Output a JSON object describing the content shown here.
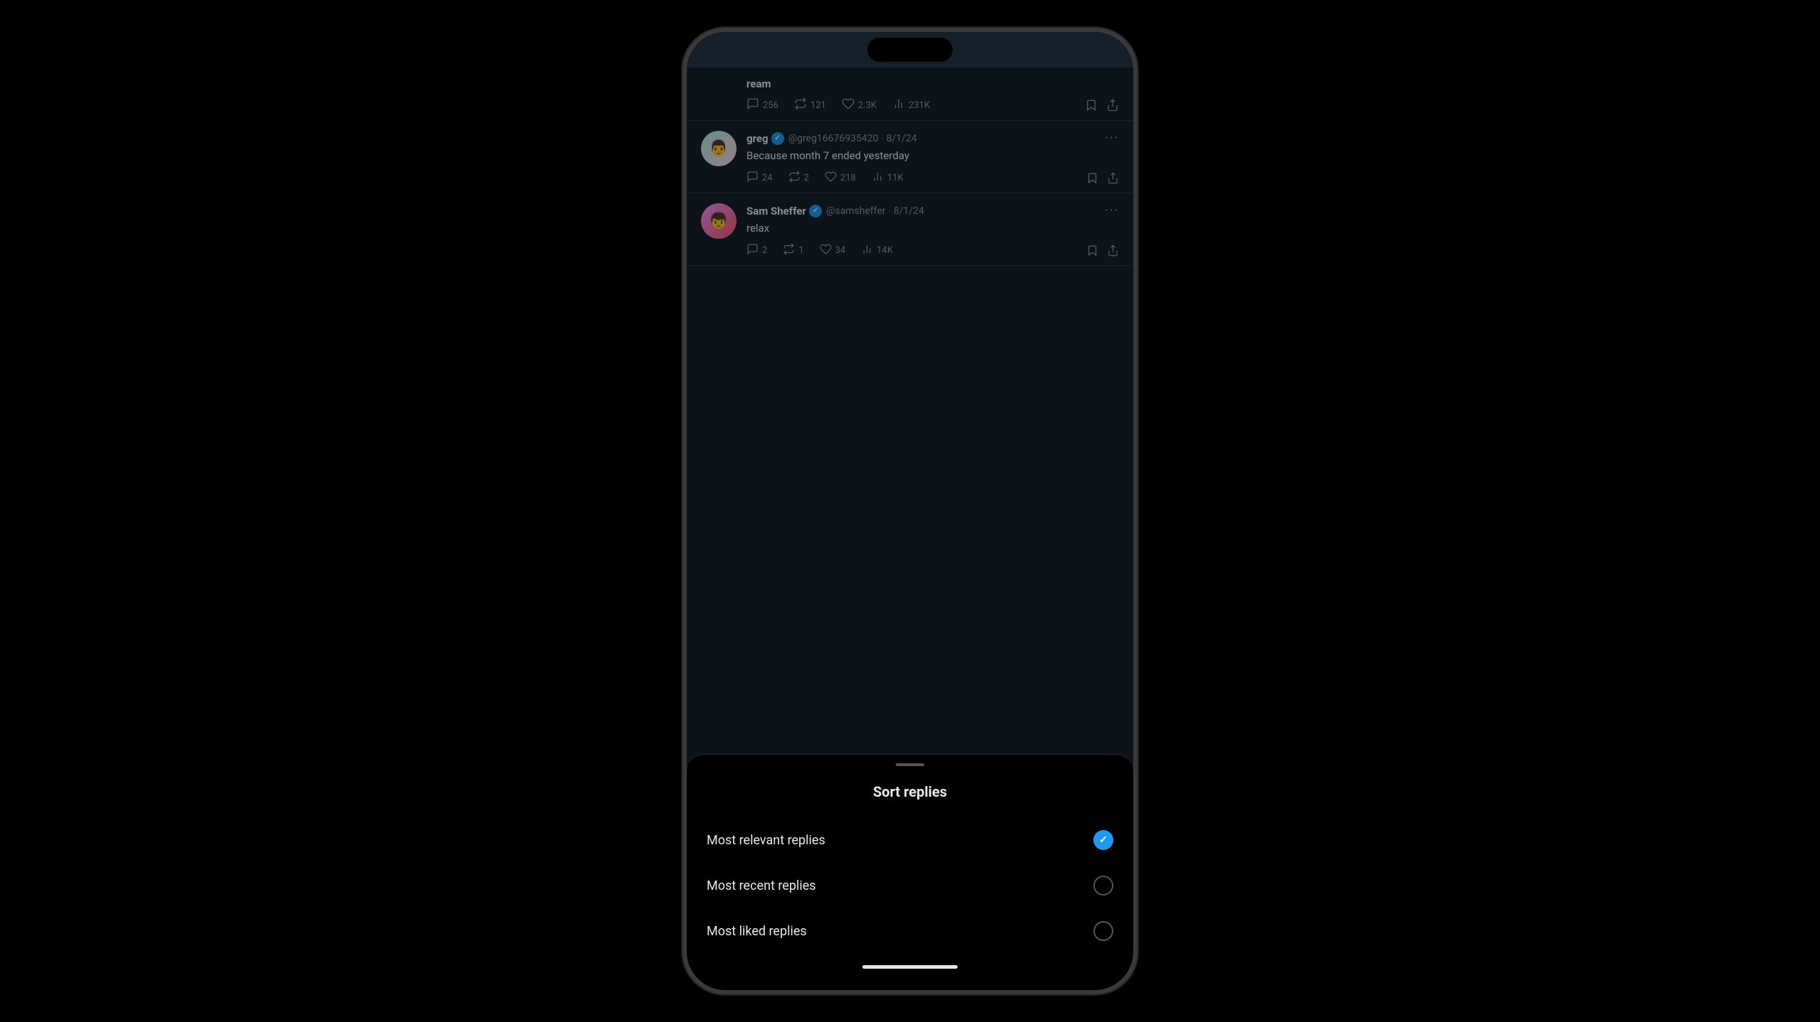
{
  "phone": {
    "background_color": "#000000"
  },
  "tweets": [
    {
      "id": "partial-top",
      "username": "ream",
      "handle": "",
      "time": "",
      "text": "",
      "actions": {
        "comments": "256",
        "retweets": "121",
        "likes": "2.3K",
        "views": "231K"
      }
    },
    {
      "id": "greg",
      "username": "greg",
      "verified": true,
      "handle": "@greg16676935420",
      "time": "8/1/24",
      "text": "Because month 7 ended yesterday",
      "actions": {
        "comments": "24",
        "retweets": "2",
        "likes": "218",
        "views": "11K"
      }
    },
    {
      "id": "sam",
      "username": "Sam Sheffer",
      "verified": true,
      "handle": "@samsheffer",
      "time": "8/1/24",
      "text": "relax",
      "actions": {
        "comments": "2",
        "retweets": "1",
        "likes": "34",
        "views": "14K"
      }
    }
  ],
  "sort_sheet": {
    "title": "Sort replies",
    "options": [
      {
        "id": "most-relevant",
        "label": "Most relevant replies",
        "selected": true
      },
      {
        "id": "most-recent",
        "label": "Most recent replies",
        "selected": false
      },
      {
        "id": "most-liked",
        "label": "Most liked replies",
        "selected": false
      }
    ]
  },
  "icons": {
    "comment": "💬",
    "retweet": "🔁",
    "like": "♡",
    "views": "📊",
    "bookmark": "🔖",
    "share": "⬆",
    "verified_check": "✓",
    "radio_check": "✓",
    "more": "···"
  }
}
